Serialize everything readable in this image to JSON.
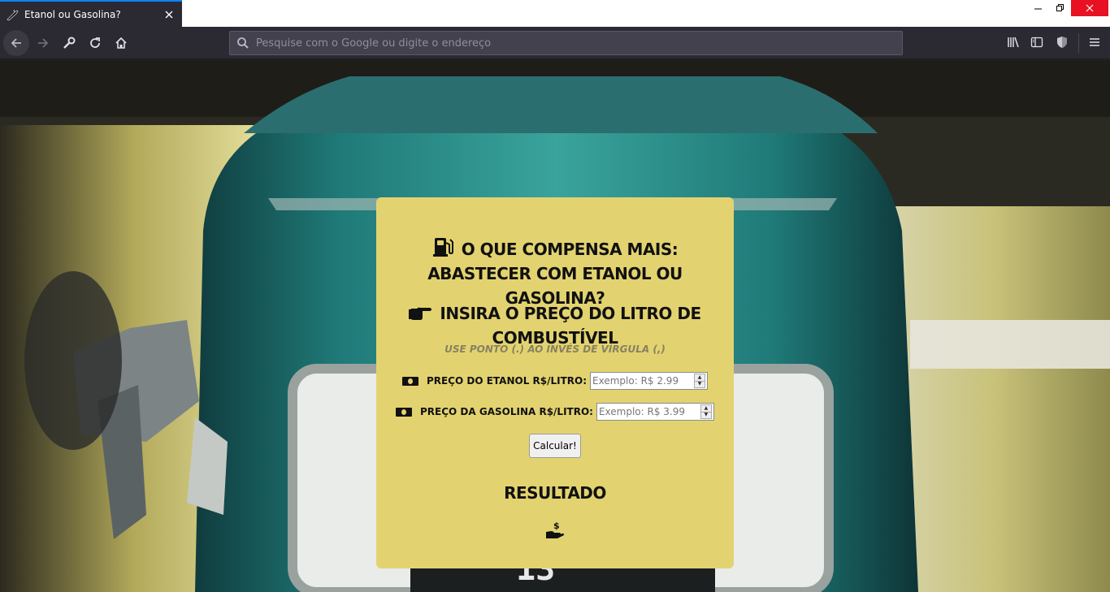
{
  "browser": {
    "tab_title": "Etanol ou Gasolina?",
    "address_placeholder": "Pesquise com o Google ou digite o endereço",
    "icons": [
      "back-arrow-icon",
      "forward-arrow-icon",
      "wrench-icon",
      "reload-icon",
      "home-icon",
      "search-icon",
      "library-icon",
      "sidebar-icon",
      "shield-icon",
      "menu-icon"
    ]
  },
  "card": {
    "title": "O que compensa mais: abastecer com etanol ou gasolina?",
    "subtitle": "Insira o preço do litro de combustível",
    "hint": "Use ponto (.) ao invés de vírgula (,)",
    "ethanol_label": "Preço do etanol R$/litro:",
    "ethanol_placeholder": "Exemplo: R$ 2.99",
    "gasoline_label": "Preço da gasolina R$/litro:",
    "gasoline_placeholder": "Exemplo: R$ 3.99",
    "calculate_button": "Calcular!",
    "result_heading": "Resultado"
  },
  "colors": {
    "card_background": "#e3d370",
    "tab_accent": "#0a84ff",
    "close_button": "#e81123",
    "pump_teal": "#1f7f7c"
  }
}
